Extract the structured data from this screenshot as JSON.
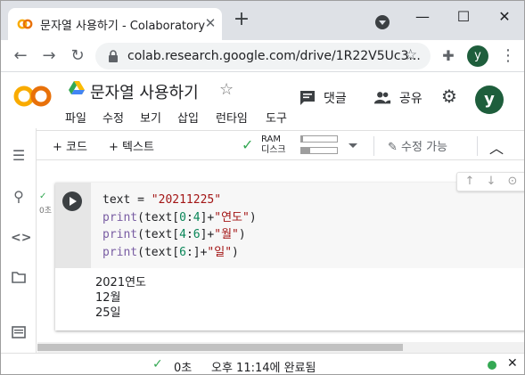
{
  "browser": {
    "tab_title": "문자열 사용하기 - Colaboratory",
    "tab_close": "✕",
    "new_tab": "+",
    "url": "colab.research.google.com/drive/1R22V5Uc3...",
    "profile_initial": "y",
    "window_minimize": "—",
    "window_maximize": "☐",
    "window_close": "✕"
  },
  "header": {
    "doc_title": "문자열 사용하기",
    "comment_label": "댓글",
    "share_label": "공유",
    "avatar_initial": "y",
    "menu": [
      "파일",
      "수정",
      "보기",
      "삽입",
      "런타임",
      "도구"
    ]
  },
  "nb_toolbar": {
    "add_code": "+ 코드",
    "add_text": "+ 텍스트",
    "ram_label": "RAM",
    "disk_label": "디스크",
    "ram_usage": 0.05,
    "disk_usage": 0.25,
    "edit_mode": "수정 가능"
  },
  "cell": {
    "exec_time": "0초",
    "code_lines": [
      [
        [
          "text",
          "op"
        ],
        [
          " = ",
          "op"
        ],
        [
          "\"20211225\"",
          "str"
        ]
      ],
      [
        [
          "print",
          "kw"
        ],
        [
          "(text[",
          "op"
        ],
        [
          "0",
          "num"
        ],
        [
          ":",
          "op"
        ],
        [
          "4",
          "num"
        ],
        [
          "]+",
          "op"
        ],
        [
          "\"연도\"",
          "str"
        ],
        [
          ")",
          "op"
        ]
      ],
      [
        [
          "print",
          "kw"
        ],
        [
          "(text[",
          "op"
        ],
        [
          "4",
          "num"
        ],
        [
          ":",
          "op"
        ],
        [
          "6",
          "num"
        ],
        [
          "]+",
          "op"
        ],
        [
          "\"월\"",
          "str"
        ],
        [
          ")",
          "op"
        ]
      ],
      [
        [
          "print",
          "kw"
        ],
        [
          "(text[",
          "op"
        ],
        [
          "6",
          "num"
        ],
        [
          ":]+",
          "op"
        ],
        [
          "\"일\"",
          "str"
        ],
        [
          ")",
          "op"
        ]
      ]
    ],
    "output": "2021연도\n12월\n25일"
  },
  "statusbar": {
    "elapsed": "0초",
    "completed": "오후 11:14에 완료됨",
    "close": "✕"
  },
  "colors": {
    "accent_green": "#34a853",
    "avatar_bg": "#1e5e3c",
    "colab_orange": "#f9ab00"
  }
}
